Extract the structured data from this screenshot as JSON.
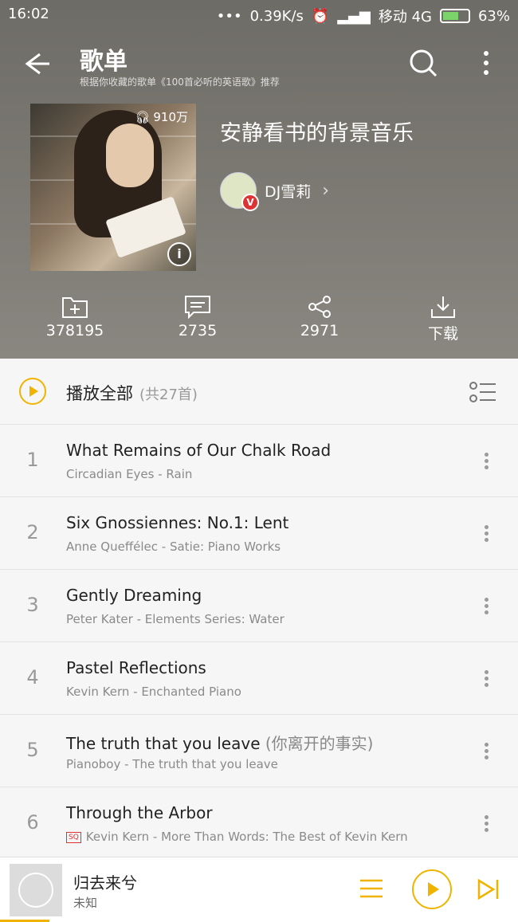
{
  "status_bar": {
    "time": "16:02",
    "network_speed": "0.39K/s",
    "carrier": "移动 4G",
    "battery": "63%",
    "battery_level": 0.63
  },
  "header": {
    "title": "歌单",
    "subtitle": "根据你收藏的歌单《100首必听的英语歌》推荐"
  },
  "playlist": {
    "name": "安静看书的背景音乐",
    "play_count": "910万",
    "author": "DJ雪莉",
    "verified_badge": "V"
  },
  "actions": [
    {
      "icon": "add-folder-icon",
      "label": "378195"
    },
    {
      "icon": "comment-icon",
      "label": "2735"
    },
    {
      "icon": "share-icon",
      "label": "2971"
    },
    {
      "icon": "download-icon",
      "label": "下载"
    }
  ],
  "play_all": {
    "label": "播放全部",
    "count": "(共27首)"
  },
  "tracks": [
    {
      "index": "1",
      "title": "What Remains of Our Chalk Road",
      "alt": "",
      "subtitle": "Circadian Eyes - Rain",
      "sq": ""
    },
    {
      "index": "2",
      "title": "Six Gnossiennes: No.1: Lent",
      "alt": "",
      "subtitle": "Anne Queffélec - Satie: Piano Works",
      "sq": ""
    },
    {
      "index": "3",
      "title": "Gently Dreaming",
      "alt": "",
      "subtitle": "Peter Kater - Elements Series: Water",
      "sq": ""
    },
    {
      "index": "4",
      "title": "Pastel Reflections",
      "alt": "",
      "subtitle": "Kevin Kern - Enchanted Piano",
      "sq": ""
    },
    {
      "index": "5",
      "title": "The truth that you leave",
      "alt": " (你离开的事实)",
      "subtitle": "Pianoboy - The truth that you leave",
      "sq": ""
    },
    {
      "index": "6",
      "title": "Through the Arbor",
      "alt": "",
      "subtitle": "Kevin Kern - More Than Words: The Best of Kevin Kern",
      "sq": "SQ"
    }
  ],
  "now_playing": {
    "song": "归去来兮",
    "artist": "未知",
    "progress": 0.095
  },
  "colors": {
    "accent": "#f0b400",
    "header_bg": "#76746d"
  }
}
